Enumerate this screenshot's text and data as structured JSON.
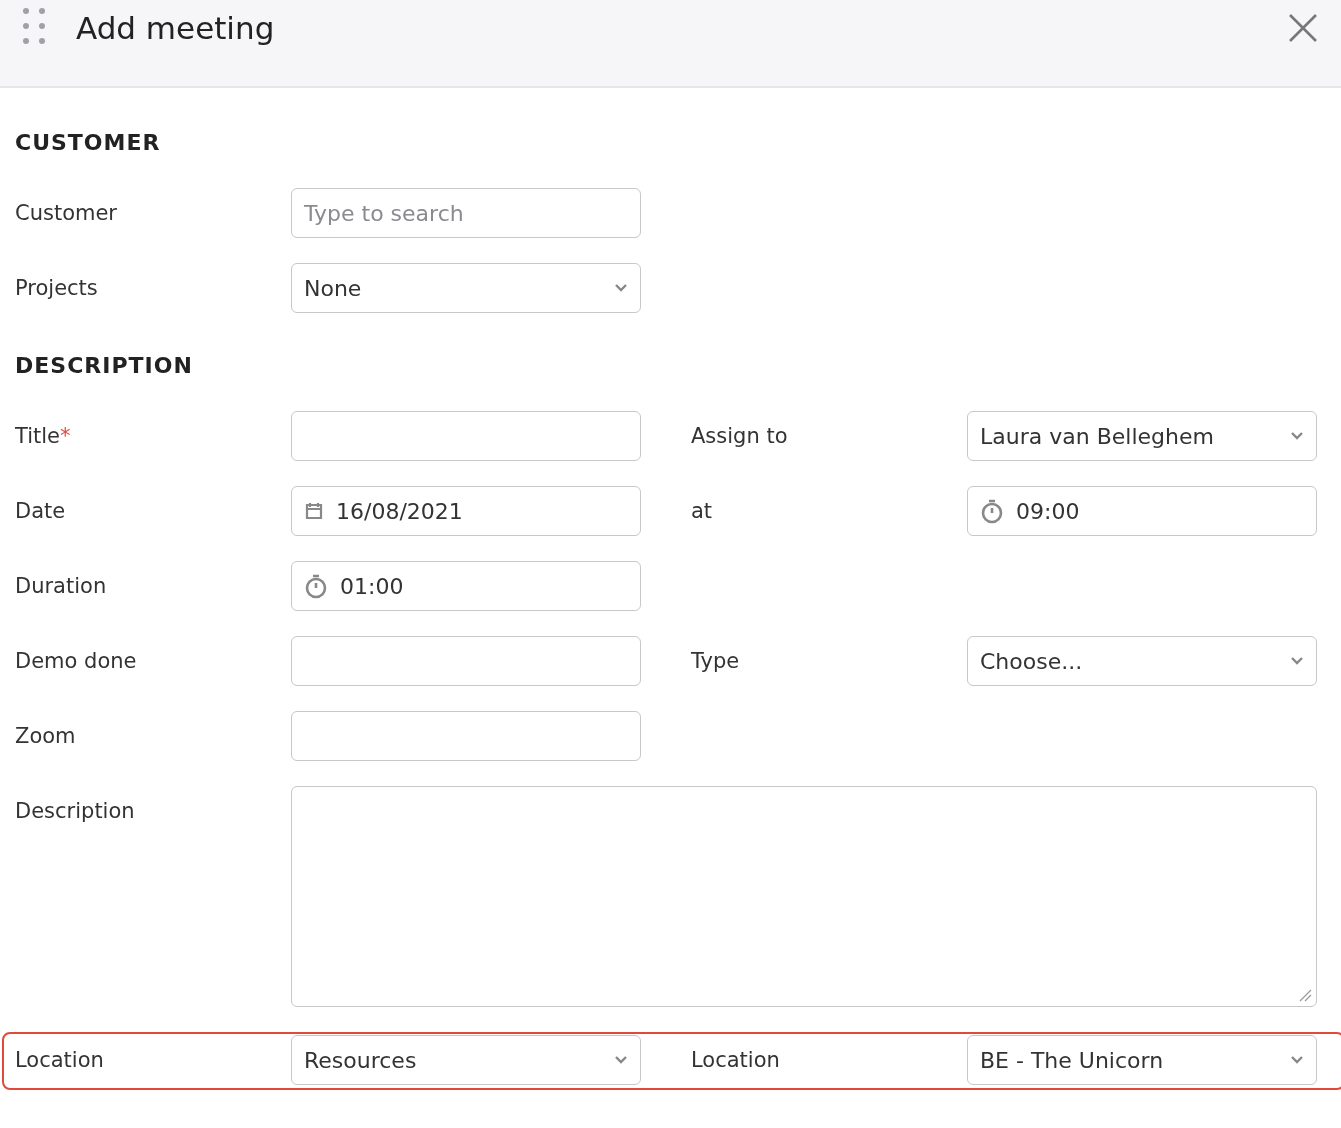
{
  "header": {
    "title": "Add meeting"
  },
  "sections": [
    {
      "heading": "CUSTOMER",
      "rows": [
        {
          "highlighted": false,
          "fields": [
            {
              "label": "Customer",
              "kind": "text",
              "placeholder": "Type to search"
            }
          ]
        },
        {
          "highlighted": false,
          "fields": [
            {
              "label": "Projects",
              "kind": "select",
              "value": "None"
            }
          ]
        }
      ]
    },
    {
      "heading": "DESCRIPTION",
      "rows": [
        {
          "highlighted": false,
          "fields": [
            {
              "label": "Title",
              "required_mark": "*",
              "kind": "text"
            },
            {
              "label": "Assign to",
              "kind": "select",
              "value": "Laura van Belleghem"
            }
          ]
        },
        {
          "highlighted": false,
          "fields": [
            {
              "label": "Date",
              "kind": "date",
              "value": "16/08/2021"
            },
            {
              "label": "at",
              "kind": "time",
              "value": "09:00"
            }
          ]
        },
        {
          "highlighted": false,
          "fields": [
            {
              "label": "Duration",
              "kind": "time",
              "value": "01:00"
            }
          ]
        },
        {
          "highlighted": false,
          "fields": [
            {
              "label": "Demo done",
              "kind": "text"
            },
            {
              "label": "Type",
              "kind": "select",
              "value": "Choose..."
            }
          ]
        },
        {
          "highlighted": false,
          "fields": [
            {
              "label": "Zoom",
              "kind": "text"
            }
          ]
        },
        {
          "highlighted": false,
          "fields": [
            {
              "label": "Description",
              "kind": "textarea"
            }
          ]
        },
        {
          "highlighted": true,
          "fields": [
            {
              "label": "Location",
              "kind": "select",
              "value": "Resources"
            },
            {
              "label": "Location",
              "kind": "select",
              "value": "BE - The Unicorn"
            }
          ]
        }
      ]
    }
  ]
}
